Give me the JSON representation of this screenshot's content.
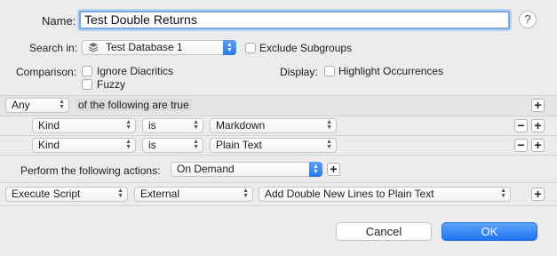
{
  "name": {
    "label": "Name:",
    "value": "Test Double Returns"
  },
  "help": {
    "symbol": "?"
  },
  "search_in": {
    "label": "Search in:",
    "value": "Test Database 1",
    "icon": "database-stack-icon"
  },
  "exclude_subgroups": {
    "label": "Exclude Subgroups",
    "checked": false
  },
  "comparison": {
    "label": "Comparison:",
    "options": [
      "Ignore Diacritics",
      "Fuzzy"
    ]
  },
  "display": {
    "label": "Display:",
    "option": "Highlight Occurrences"
  },
  "match": {
    "quantifier": "Any",
    "suffix": "of the following are true"
  },
  "conditions": [
    {
      "field": "Kind",
      "operator": "is",
      "value": "Markdown"
    },
    {
      "field": "Kind",
      "operator": "is",
      "value": "Plain Text"
    }
  ],
  "perform": {
    "label": "Perform the following actions:",
    "value": "On Demand"
  },
  "action": {
    "type": "Execute Script",
    "mode": "External",
    "script": "Add Double New Lines to Plain Text"
  },
  "symbols": {
    "plus": "+",
    "minus": "−"
  },
  "buttons": {
    "cancel": "Cancel",
    "ok": "OK"
  },
  "colors": {
    "accent": "#1f74f0",
    "focus_ring": "#7aa9e0"
  }
}
